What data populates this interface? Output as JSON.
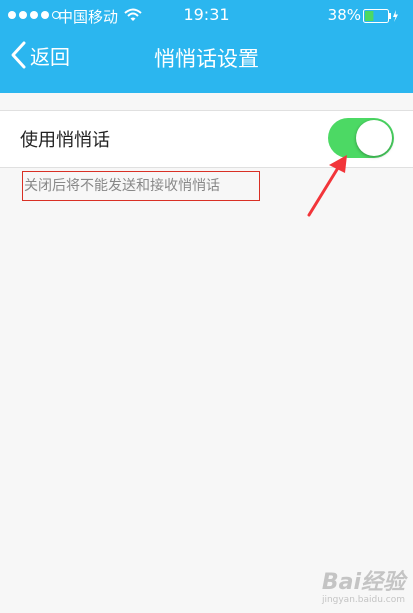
{
  "status_bar": {
    "carrier": "中国移动",
    "time": "19:31",
    "battery_percent": "38%",
    "battery_level": 0.38,
    "signal_bars": 4
  },
  "nav": {
    "back_label": "返回",
    "title": "悄悄话设置"
  },
  "settings": {
    "whisper_label": "使用悄悄话",
    "whisper_enabled": true,
    "description": "关闭后将不能发送和接收悄悄话"
  },
  "watermark": {
    "brand": "Bai经验",
    "url": "jingyan.baidu.com"
  },
  "colors": {
    "header": "#2bb6ef",
    "toggle_on": "#4cd964",
    "annotation": "#d93025",
    "battery_fill": "#4cd964"
  },
  "icons": [
    "wifi-icon",
    "battery-icon",
    "charging-icon",
    "chevron-left-icon",
    "annotation-arrow"
  ]
}
